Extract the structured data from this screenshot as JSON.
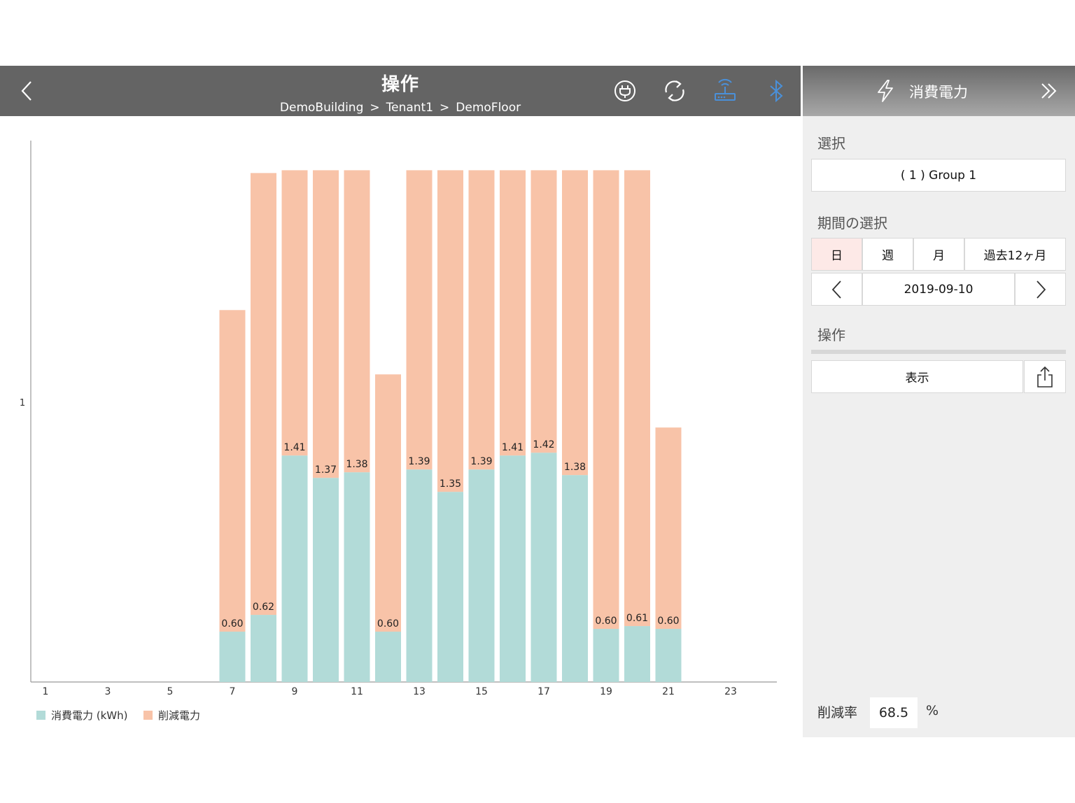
{
  "header": {
    "title": "操作",
    "breadcrumb": [
      "DemoBuilding",
      "Tenant1",
      "DemoFloor"
    ],
    "breadcrumb_separator": ">"
  },
  "panel": {
    "title": "消費電力",
    "selection_label": "選択",
    "group_value": "( 1 ) Group 1",
    "period_label": "期間の選択",
    "period_options": [
      "日",
      "週",
      "月",
      "過去12ヶ月"
    ],
    "period_selected": "日",
    "date": "2019-09-10",
    "operation_label": "操作",
    "operation_progress": 0,
    "display_button": "表示",
    "reduction_rate_label": "削減率",
    "reduction_rate_value": "68.5",
    "reduction_rate_unit": "%"
  },
  "colors": {
    "consumption": "#b2dbd8",
    "reduction": "#f8c3a8",
    "header_bg": "#646464",
    "bluetooth": "#4a90d9",
    "router": "#4a90d9"
  },
  "icons": {
    "back": "chevron-left-icon",
    "plug": "plug-icon",
    "refresh": "refresh-icon",
    "router": "router-icon",
    "bluetooth": "bluetooth-icon",
    "panel_title": "lightning-icon",
    "collapse": "double-chevron-right-icon",
    "prev_date": "chevron-left-icon",
    "next_date": "chevron-right-icon",
    "export": "share-icon"
  },
  "chart_data": {
    "type": "bar",
    "stacked": true,
    "x_tick_labels": [
      "1",
      "3",
      "5",
      "7",
      "9",
      "11",
      "13",
      "15",
      "17",
      "19",
      "21",
      "23"
    ],
    "x": [
      7,
      8,
      9,
      10,
      11,
      12,
      13,
      14,
      15,
      16,
      17,
      18,
      19,
      20,
      21
    ],
    "y_ticks": [
      "1"
    ],
    "ylim": [
      0,
      1.936
    ],
    "series": [
      {
        "name": "消費電力 (kWh)",
        "values": [
          0.18,
          0.24,
          0.81,
          0.73,
          0.75,
          0.18,
          0.76,
          0.68,
          0.76,
          0.81,
          0.82,
          0.74,
          0.19,
          0.2,
          0.19
        ]
      },
      {
        "name": "削減電力",
        "values": [
          1.15,
          1.58,
          1.02,
          1.1,
          1.08,
          0.92,
          1.07,
          1.15,
          1.07,
          1.02,
          1.01,
          1.09,
          1.64,
          1.63,
          0.72
        ]
      }
    ],
    "data_labels": [
      "0.60",
      "0.62",
      "1.41",
      "1.37",
      "1.38",
      "0.60",
      "1.39",
      "1.35",
      "1.39",
      "1.41",
      "1.42",
      "1.38",
      "0.60",
      "0.61",
      "0.60"
    ],
    "legend_position": "bottom-left",
    "grid": false
  }
}
